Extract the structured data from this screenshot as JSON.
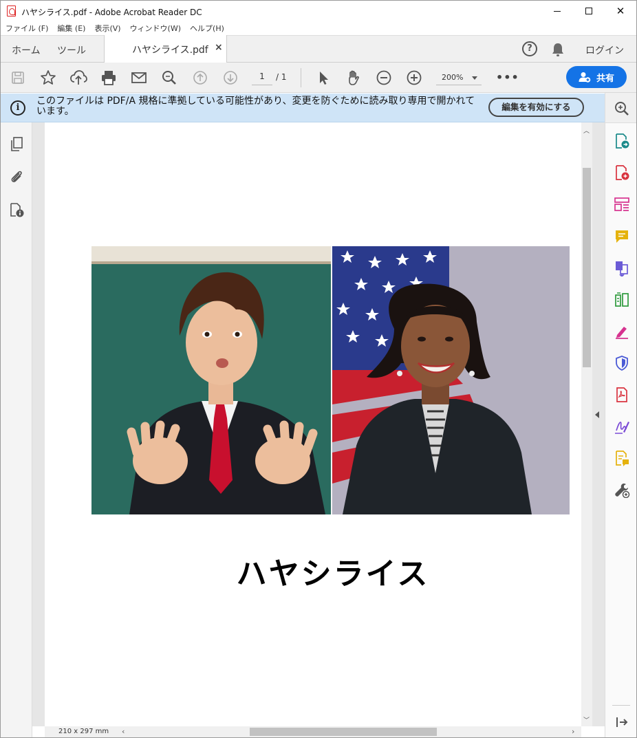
{
  "window": {
    "title": "ハヤシライス.pdf - Adobe Acrobat Reader DC",
    "min": "—",
    "max": "☐",
    "close": "✕"
  },
  "menu": [
    "ファイル (F)",
    "編集 (E)",
    "表示(V)",
    "ウィンドウ(W)",
    "ヘルプ(H)"
  ],
  "tabs": {
    "home": "ホーム",
    "tools": "ツール",
    "document": "ハヤシライス.pdf",
    "document_close": "×"
  },
  "header_right": {
    "help": "?",
    "login": "ログイン"
  },
  "toolbar": {
    "page_current": "1",
    "page_total": "/ 1",
    "zoom": "200%",
    "more": "•••",
    "share": "共有"
  },
  "banner": {
    "info_icon": "i",
    "message": "このファイルは PDF/A 規格に準拠している可能性があり、変更を防ぐために読み取り専用で開かれています。",
    "enable_edit": "編集を有効にする"
  },
  "document": {
    "title": "ハヤシライス"
  },
  "statusbar": {
    "page_size": "210 x 297 mm"
  },
  "colors": {
    "accent": "#1473e6",
    "banner_bg": "#cfe4f7"
  },
  "right_panel_icons": [
    "search-zoom-icon",
    "export-pdf-icon",
    "create-pdf-icon",
    "edit-pdf-icon",
    "comment-icon",
    "combine-files-icon",
    "organize-pages-icon",
    "fill-sign-icon",
    "protect-icon",
    "pdf-icon",
    "sign-icon",
    "send-for-comments-icon",
    "more-tools-icon"
  ]
}
